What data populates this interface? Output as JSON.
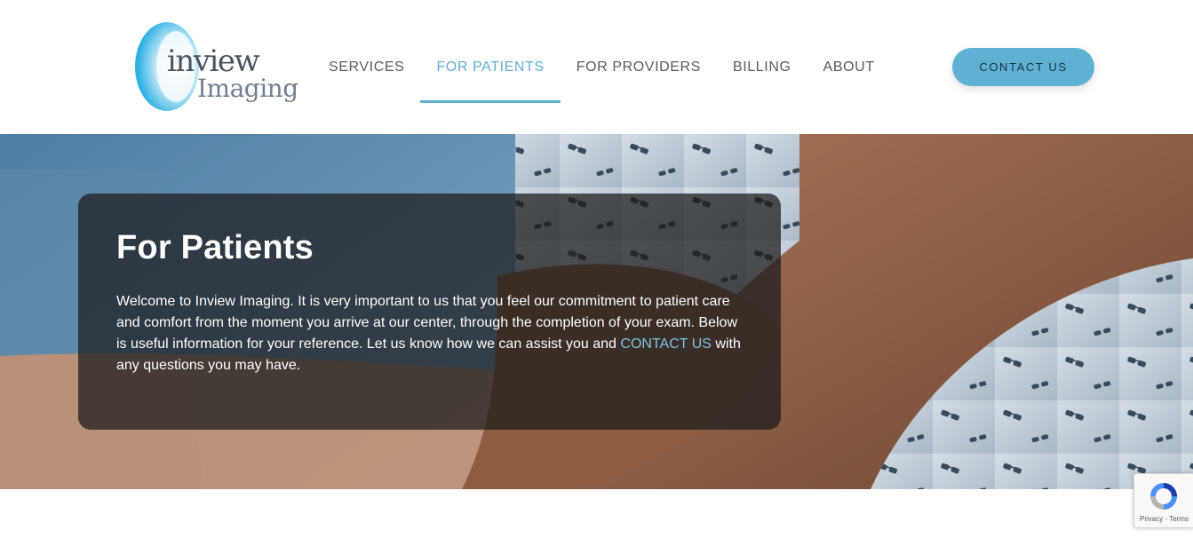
{
  "header": {
    "logo_line1": "inview",
    "logo_line2": "Imaging",
    "nav": [
      {
        "label": "SERVICES",
        "active": false
      },
      {
        "label": "FOR PATIENTS",
        "active": true
      },
      {
        "label": "FOR PROVIDERS",
        "active": false
      },
      {
        "label": "BILLING",
        "active": false
      },
      {
        "label": "ABOUT",
        "active": false
      }
    ],
    "contact_label": "CONTACT US"
  },
  "hero": {
    "title": "For Patients",
    "text_before": "Welcome to Inview Imaging. It is very important to us that you feel our commitment to patient care and comfort from the moment you arrive at our center, through the completion of your exam. Below is useful information for your reference. Let us know how we can assist you and ",
    "link": "CONTACT US",
    "text_after": " with any questions you may have."
  },
  "recaptcha": {
    "links": "Privacy - Terms"
  },
  "colors": {
    "accent": "#5fb0d3",
    "nav_text": "#5b5b5b",
    "overlay": "#1c1c1e"
  }
}
